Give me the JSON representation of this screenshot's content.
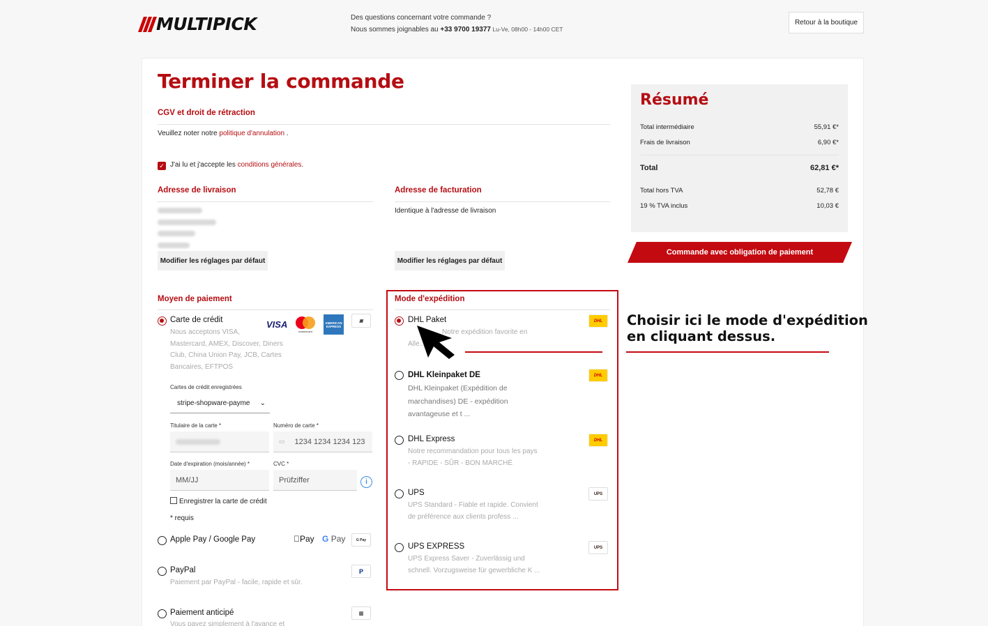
{
  "header": {
    "brand": "MULTIPICK",
    "help_question": "Des questions concernant votre commande ?",
    "help_prefix": "Nous sommes joignables au ",
    "help_phone": "+33 9700 19377",
    "help_hours": " Lu-Ve, 08h00 - 14h00 CET",
    "back_label": "Retour à la boutique"
  },
  "page": {
    "title": "Terminer la commande"
  },
  "terms": {
    "heading": "CGV et droit de rétraction",
    "note_prefix": "Veuillez noter notre ",
    "note_link": "politique d'annulation",
    "note_suffix": " .",
    "accept_prefix": "J'ai lu et j'accepte les ",
    "accept_link": "conditions générales",
    "accept_suffix": ".",
    "accepted": true
  },
  "delivery_address": {
    "heading": "Adresse de livraison",
    "edit_label": "Modifier les réglages par défaut"
  },
  "billing_address": {
    "heading": "Adresse de facturation",
    "text": "Identique à l'adresse de livraison",
    "edit_label": "Modifier les réglages par défaut"
  },
  "payment": {
    "heading": "Moyen de paiement",
    "credit_card": {
      "label": "Carte de crédit",
      "desc_line1": "Nous acceptons VISA,",
      "desc_line2": "Mastercard, AMEX, Discover, Diners",
      "desc_line3": "Club, China Union Pay, JCB, Cartes",
      "desc_line4": "Bancaires, EFTPOS",
      "saved_label": "Cartes de crédit enregistrées",
      "saved_value": "stripe-shopware-payme",
      "holder_label": "Titulaire de la carte *",
      "number_label": "Numéro de carte *",
      "number_placeholder": "1234 1234 1234 123",
      "expiry_label": "Date d'expiration (mois/année) *",
      "expiry_placeholder": "MM/JJ",
      "cvc_label": "CVC *",
      "cvc_placeholder": "Prüfziffer",
      "save_card_label": "Enregistrer la carte de crédit",
      "required_note": "* requis",
      "brand_visa": "VISA",
      "brand_mastercard": "mastercard",
      "brand_amex": "AMERICAN EXPRESS"
    },
    "wallet": {
      "label": "Apple Pay / Google Pay",
      "apple": "Pay",
      "google": "Pay"
    },
    "paypal": {
      "label": "PayPal",
      "desc": "Paiement par PayPal - facile, rapide et sûr."
    },
    "prepay": {
      "label": "Paiement anticipé",
      "desc": "Vous payez simplement à l'avance et"
    }
  },
  "shipping": {
    "heading": "Mode d'expédition",
    "options": [
      {
        "label": "DHL Paket",
        "desc1": "Notre expédition favorite en",
        "desc2": "Alle...",
        "selected": true,
        "logo": "DHL"
      },
      {
        "label": "DHL Kleinpaket DE",
        "desc1": "DHL Kleinpaket (Expédition de",
        "desc2": "marchandises) DE - expédition",
        "desc3": "avantageuse et t ...",
        "selected": false,
        "logo": "DHL"
      },
      {
        "label": "DHL Express",
        "desc1": "Notre recommandation pour tous les pays",
        "desc2": "- RAPIDE - SÛR - BON MARCHÉ",
        "selected": false,
        "logo": "DHL"
      },
      {
        "label": "UPS",
        "desc1": "UPS Standard - Fiable et rapide. Convient",
        "desc2": "de préférence aux clients profess ...",
        "selected": false,
        "logo": "UPS"
      },
      {
        "label": "UPS EXPRESS",
        "desc1": "UPS Express Saver - Zuverlässig und",
        "desc2": "schnell. Vorzugsweise für gewerbliche K ...",
        "selected": false,
        "logo": "UPS"
      }
    ]
  },
  "summary": {
    "title": "Résumé",
    "subtotal_label": "Total intermédiaire",
    "subtotal_value": "55,91 €*",
    "shipping_label": "Frais de livraison",
    "shipping_value": "6,90 €*",
    "total_label": "Total",
    "total_value": "62,81 €*",
    "net_label": "Total hors TVA",
    "net_value": "52,78 €",
    "vat_label": "19 % TVA inclus",
    "vat_value": "10,03 €",
    "order_button": "Commande avec obligation de paiement"
  },
  "annotation": {
    "line1": "Choisir ici le mode d'expédition",
    "line2": "en cliquant dessus."
  },
  "colors": {
    "brand_red": "#b50d12",
    "button_red": "#c40a11"
  }
}
